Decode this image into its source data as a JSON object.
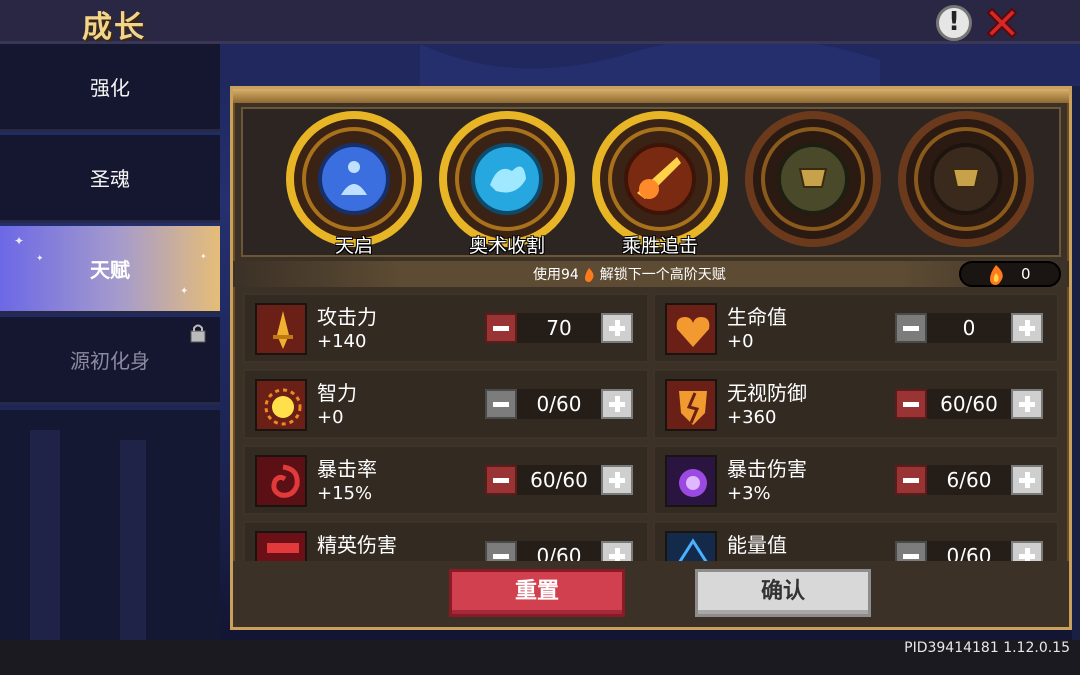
{
  "header": {
    "title": "成长"
  },
  "sidebar": {
    "items": [
      {
        "label": "强化"
      },
      {
        "label": "圣魂"
      },
      {
        "label": "天赋"
      },
      {
        "label": "源初化身"
      }
    ]
  },
  "talents": [
    {
      "name": "天启",
      "icon": "meditating-figure-icon",
      "color": "#3b6fe0"
    },
    {
      "name": "奥术收割",
      "icon": "arcane-spirit-icon",
      "color": "#27a7e0"
    },
    {
      "name": "乘胜追击",
      "icon": "fire-slash-icon",
      "color": "#e08a27"
    },
    {
      "name": "",
      "icon": "locked-crest-icon",
      "color": "#6a6a3a"
    },
    {
      "name": "",
      "icon": "locked-crest-icon",
      "color": "#4a3a2a"
    }
  ],
  "hint": {
    "text": "使用94",
    "text2": "解锁下一个高阶天赋"
  },
  "currency": {
    "icon": "fire-icon",
    "value": "0"
  },
  "stats": [
    {
      "name": "攻击力",
      "value": "+140",
      "count": "70",
      "icon": "sword-icon",
      "minus_enabled": true
    },
    {
      "name": "生命值",
      "value": "+0",
      "count": "0",
      "icon": "heart-icon",
      "minus_enabled": false
    },
    {
      "name": "智力",
      "value": "+0",
      "count": "0/60",
      "icon": "sun-orb-icon",
      "minus_enabled": false
    },
    {
      "name": "无视防御",
      "value": "+360",
      "count": "60/60",
      "icon": "broken-shield-icon",
      "minus_enabled": true
    },
    {
      "name": "暴击率",
      "value": "+15%",
      "count": "60/60",
      "icon": "red-swirl-icon",
      "minus_enabled": true
    },
    {
      "name": "暴击伤害",
      "value": "+3%",
      "count": "6/60",
      "icon": "purple-orb-icon",
      "minus_enabled": true
    },
    {
      "name": "精英伤害",
      "value": "",
      "count": "0/60",
      "icon": "elite-crest-icon",
      "minus_enabled": false
    },
    {
      "name": "能量值",
      "value": "",
      "count": "0/60",
      "icon": "energy-triangle-icon",
      "minus_enabled": false
    }
  ],
  "buttons": {
    "reset": "重置",
    "confirm": "确认"
  },
  "footer": {
    "version": "PID39414181 1.12.0.15"
  }
}
